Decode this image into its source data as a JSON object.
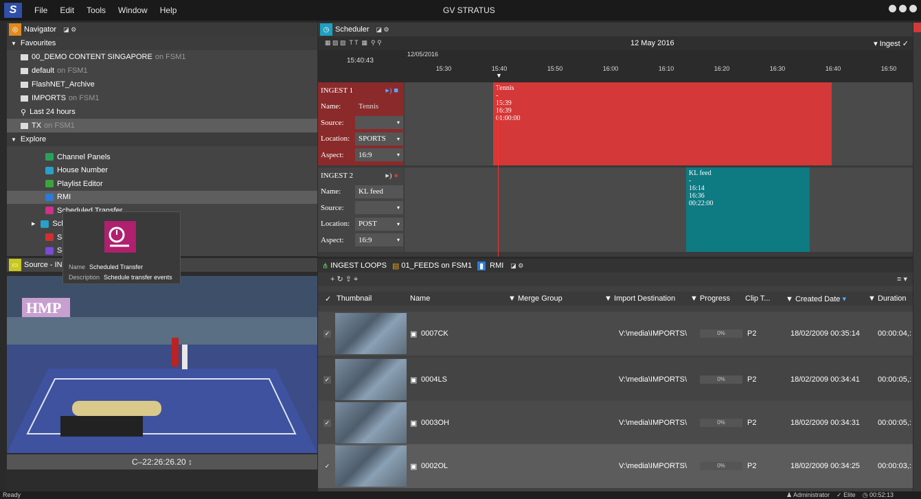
{
  "app": {
    "title": "GV STRATUS",
    "logo": "S"
  },
  "menu": [
    "File",
    "Edit",
    "Tools",
    "Window",
    "Help"
  ],
  "navigator": {
    "title": "Navigator",
    "favourites_label": "Favourites",
    "favourites": [
      {
        "name": "00_DEMO CONTENT SINGAPORE",
        "suffix": "on FSM1"
      },
      {
        "name": "default",
        "suffix": "on FSM1"
      },
      {
        "name": "FlashNET_Archive",
        "suffix": ""
      },
      {
        "name": "IMPORTS",
        "suffix": "on FSM1"
      },
      {
        "name": "Last 24 hours",
        "suffix": ""
      },
      {
        "name": "TX",
        "suffix": "on FSM1"
      }
    ],
    "explore_label": "Explore",
    "explore": [
      {
        "name": "Channel Panels",
        "color": "#2aa05a"
      },
      {
        "name": "House Number",
        "color": "#2aa0c8"
      },
      {
        "name": "Playlist Editor",
        "color": "#3aa53a"
      },
      {
        "name": "RMI",
        "color": "#2a7ad8"
      },
      {
        "name": "Scheduled Transfer",
        "color": "#d0308a"
      },
      {
        "name": "Sche",
        "color": "#2aa0c8"
      },
      {
        "name": "Segi",
        "color": "#d03030"
      },
      {
        "name": "Send",
        "color": "#7a4ad8"
      }
    ]
  },
  "tooltip": {
    "name_label": "Name",
    "name_value": "Scheduled Transfer",
    "desc_label": "Description",
    "desc_value": "Schedule transfer events"
  },
  "source": {
    "title": "Source - INC",
    "timecode": "C–22:26:26.20 ↕"
  },
  "scheduler": {
    "title": "Scheduler",
    "date": "12 May 2016",
    "ingest_label": "Ingest",
    "current_time": "15:40:43",
    "date_small": "12/05/2016",
    "ticks": [
      "15:30",
      "15:40",
      "15:50",
      "16:00",
      "16:10",
      "16:20",
      "16:30",
      "16:40",
      "16:50"
    ],
    "lanes": [
      {
        "name": "INGEST 1",
        "name_label": "Name:",
        "name_value": "Tennis",
        "source_label": "Source:",
        "source_value": "",
        "location_label": "Location:",
        "location_value": "SPORTS",
        "aspect_label": "Aspect:",
        "aspect_value": "16:9",
        "event": {
          "title": "Tennis",
          "dash": "-",
          "start": "15:39",
          "end": "16:39",
          "duration": "01:00:00",
          "color": "#d43838"
        }
      },
      {
        "name": "INGEST 2",
        "name_label": "Name:",
        "name_value": "KL feed",
        "source_label": "Source:",
        "source_value": "",
        "location_label": "Location:",
        "location_value": "POST",
        "aspect_label": "Aspect:",
        "aspect_value": "16:9",
        "event": {
          "title": "KL feed",
          "dash": "-",
          "start": "16:14",
          "end": "16:36",
          "duration": "00:22:00",
          "color": "#0e7a82"
        }
      }
    ]
  },
  "list": {
    "tabs": [
      "INGEST LOOPS",
      "01_FEEDS on FSM1",
      "RMI"
    ],
    "columns": [
      "Thumbnail",
      "Name",
      "Merge Group",
      "Import Destination",
      "Progress",
      "Clip T...",
      "Created Date",
      "Duration"
    ],
    "rows": [
      {
        "name": "0007CK",
        "dest": "V:\\media\\IMPORTS\\",
        "progress": "0%",
        "clip": "P2",
        "created": "18/02/2009 00:35:14",
        "duration": "00:00:04,:"
      },
      {
        "name": "0004LS",
        "dest": "V:\\media\\IMPORTS\\",
        "progress": "0%",
        "clip": "P2",
        "created": "18/02/2009 00:34:41",
        "duration": "00:00:05,:"
      },
      {
        "name": "0003OH",
        "dest": "V:\\media\\IMPORTS\\",
        "progress": "0%",
        "clip": "P2",
        "created": "18/02/2009 00:34:31",
        "duration": "00:00:05,:"
      },
      {
        "name": "0002OL",
        "dest": "V:\\media\\IMPORTS\\",
        "progress": "0%",
        "clip": "P2",
        "created": "18/02/2009 00:34:25",
        "duration": "00:00:03,:"
      }
    ]
  },
  "status": {
    "left": "Ready",
    "user": "Administrator",
    "edition": "Elite",
    "clock": "00:52:13"
  }
}
